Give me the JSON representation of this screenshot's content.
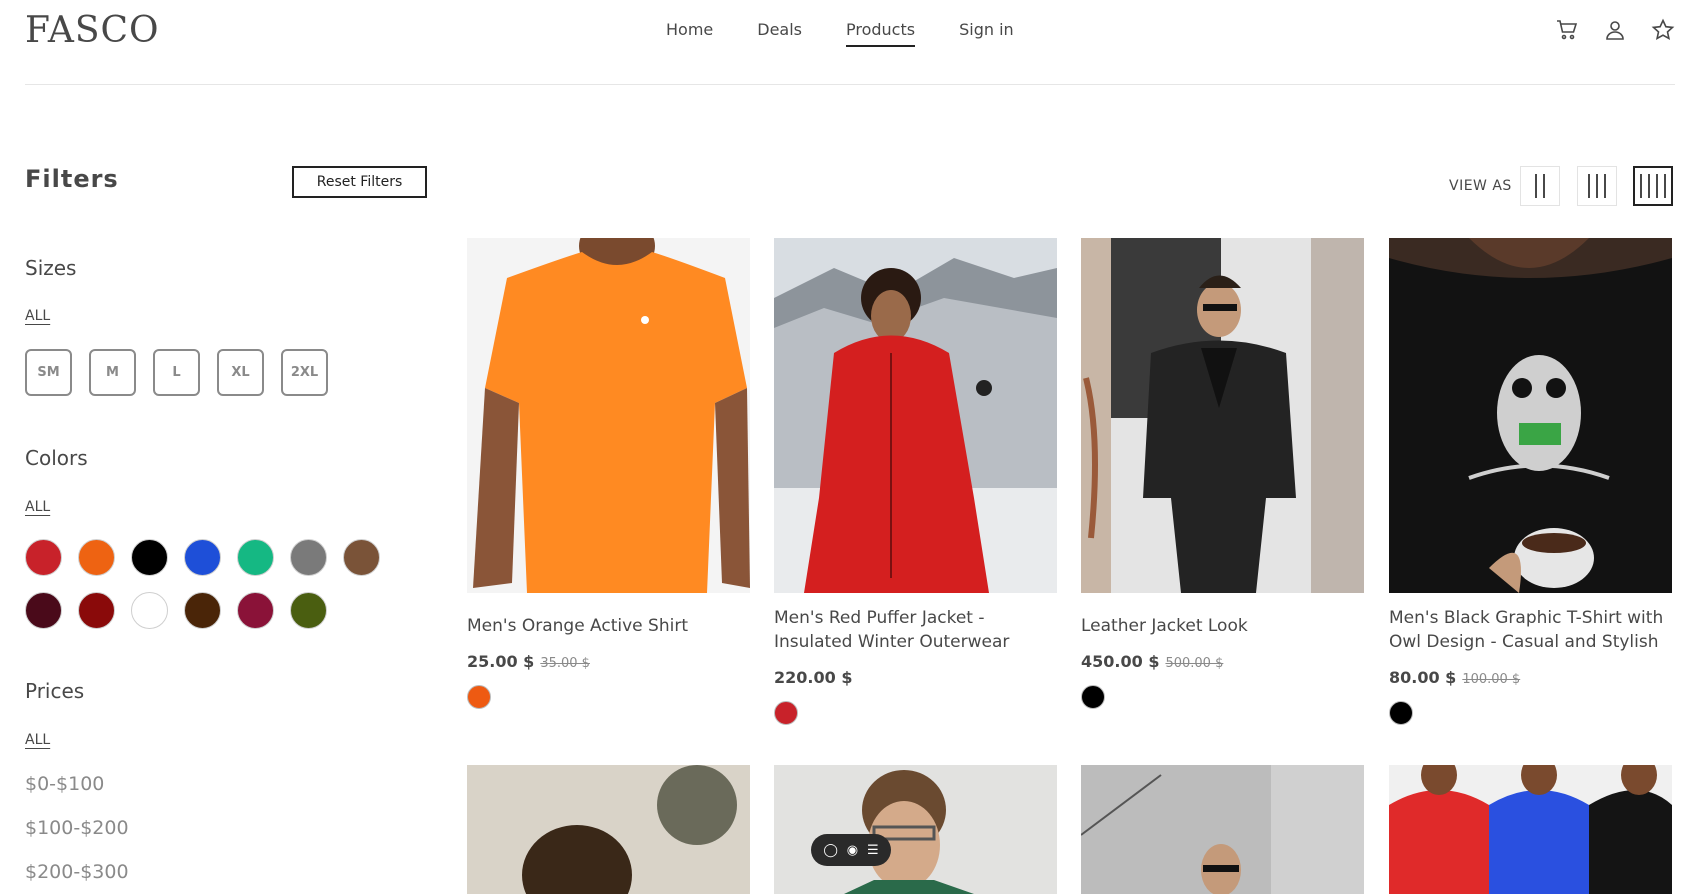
{
  "header": {
    "logo": "FASCO",
    "nav": [
      {
        "label": "Home"
      },
      {
        "label": "Deals"
      },
      {
        "label": "Products"
      },
      {
        "label": "Sign in"
      }
    ],
    "icons": [
      "cart-icon",
      "user-icon",
      "star-icon"
    ]
  },
  "filters": {
    "title": "Filters",
    "reset_label": "Reset Filters",
    "sizes_title": "Sizes",
    "sizes_all": "ALL",
    "sizes": [
      "SM",
      "M",
      "L",
      "XL",
      "2XL"
    ],
    "colors_title": "Colors",
    "colors_all": "ALL",
    "colors": [
      "#c8222a",
      "#ee6312",
      "#000000",
      "#1e4fd8",
      "#15b883",
      "#7a7a7a",
      "#7a5338",
      "#4a0a1a",
      "#8a0a0a",
      "#ffffff",
      "#4a2508",
      "#8a1238",
      "#4a5e10"
    ],
    "prices_title": "Prices",
    "prices_all": "ALL",
    "prices": [
      "$0-$100",
      "$100-$200",
      "$200-$300"
    ]
  },
  "view": {
    "label": "VIEW AS"
  },
  "products": [
    {
      "name": "Men's Orange Active Shirt",
      "price": "25.00 $",
      "old_price": "35.00 $",
      "color": "#ee5a12"
    },
    {
      "name": "Men's Red Puffer Jacket - Insulated Winter Outerwear",
      "price": "220.00 $",
      "old_price": "",
      "color": "#c8222a"
    },
    {
      "name": "Leather Jacket Look",
      "price": "450.00 $",
      "old_price": "500.00 $",
      "color": "#000000"
    },
    {
      "name": "Men's Black Graphic T-Shirt with Owl Design - Casual and Stylish",
      "price": "80.00 $",
      "old_price": "100.00 $",
      "color": "#000000"
    }
  ]
}
